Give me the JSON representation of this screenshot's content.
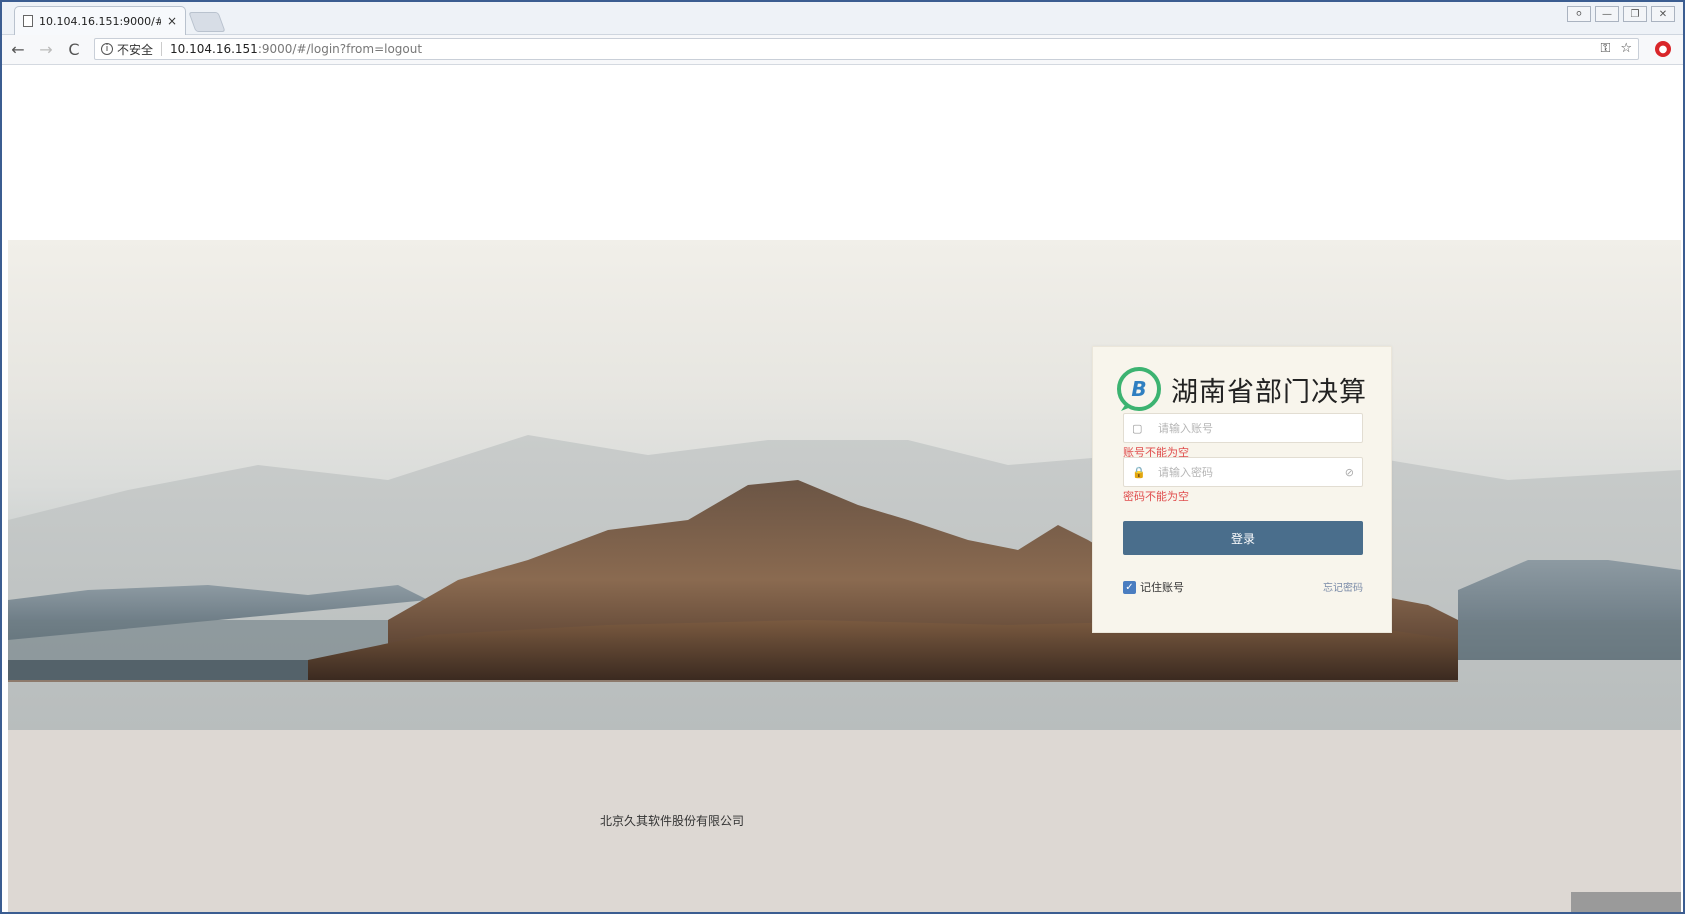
{
  "browser": {
    "tab_title": "10.104.16.151:9000/#/l",
    "tab_close": "×",
    "security_label": "不安全",
    "url_host": "10.104.16.151",
    "url_rest": ":9000/#/login?from=logout",
    "back_glyph": "←",
    "forward_glyph": "→",
    "reload_glyph": "C",
    "key_glyph": "⚿",
    "star_glyph": "☆"
  },
  "login": {
    "brand_title": "湖南省部门决算",
    "logo_letter": "B",
    "account_placeholder": "请输入账号",
    "account_error": "账号不能为空",
    "password_placeholder": "请输入密码",
    "password_error": "密码不能为空",
    "login_button": "登录",
    "remember_label": "记住账号",
    "remember_checked": true,
    "forgot_label": "忘记密码"
  },
  "footer": {
    "company": "北京久其软件股份有限公司"
  },
  "colors": {
    "primary_button": "#4a6e8c",
    "error_text": "#e04e4e",
    "logo_green": "#3cb371",
    "logo_blue": "#2f7fc1"
  }
}
